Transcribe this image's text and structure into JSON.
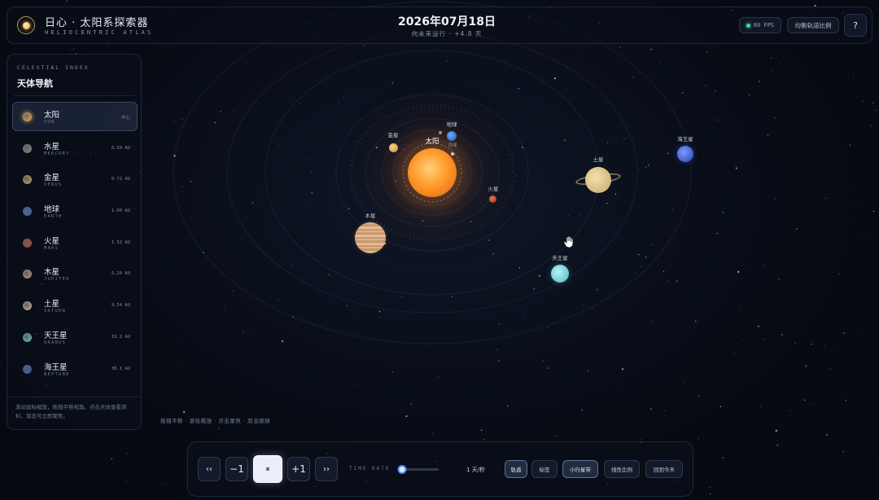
{
  "header": {
    "title": "日心 · 太阳系探索器",
    "subtitle": "HELIOCENTRIC ATLAS",
    "date": "2026年07月18日",
    "direction": "向未来运行 · +4.8 天",
    "fps": "60 FPS",
    "scale_button": "均衡轨道比例",
    "help_button": "?"
  },
  "sidebar": {
    "eyebrow": "CELESTIAL INDEX",
    "title": "天体导航",
    "items": [
      {
        "name": "太阳",
        "en": "SUN",
        "dist": "中心",
        "color": "#f2a93b",
        "active": true
      },
      {
        "name": "水星",
        "en": "MERCURY",
        "dist": "0.39 AU",
        "color": "#8f8a84",
        "active": false
      },
      {
        "name": "金星",
        "en": "VENUS",
        "dist": "0.72 AU",
        "color": "#d9a44a",
        "active": false
      },
      {
        "name": "地球",
        "en": "EARTH",
        "dist": "1.00 AU",
        "color": "#2f6fd0",
        "active": false
      },
      {
        "name": "火星",
        "en": "MARS",
        "dist": "1.52 AU",
        "color": "#c4452c",
        "active": false
      },
      {
        "name": "木星",
        "en": "JUPITER",
        "dist": "5.20 AU",
        "color": "#c89b72",
        "active": false
      },
      {
        "name": "土星",
        "en": "SATURN",
        "dist": "9.54 AU",
        "color": "#d8c08a",
        "active": false
      },
      {
        "name": "天王星",
        "en": "URANUS",
        "dist": "19.2 AU",
        "color": "#5ec8d2",
        "active": false
      },
      {
        "name": "海王星",
        "en": "NEPTUNE",
        "dist": "30.1 AU",
        "color": "#3358c8",
        "active": false
      }
    ],
    "hint": "滚动鼠标缩放，拖拽平移视角。点击天体查看资料，双击可立即聚焦。"
  },
  "canvas": {
    "hint": "拖拽平移 · 滚轮缩放 · 点击聚焦 · 双击跟随",
    "labels": {
      "sun": "太阳",
      "mercury": "水星",
      "venus": "金星",
      "earth": "地球",
      "moon": "月球",
      "mars": "火星",
      "jupiter": "木星",
      "saturn": "土星",
      "uranus": "天王星",
      "neptune": "海王星"
    }
  },
  "controls": {
    "rewind_fast": "‹‹",
    "step_back": "−1",
    "pause": "⏸",
    "step_forward": "+1",
    "forward_fast": "››",
    "time_rate_label": "TIME RATE",
    "rate_fraction": 0.1,
    "rate_readout": "1 天/秒",
    "toggles": [
      {
        "label": "轨道",
        "on": true
      },
      {
        "label": "标签",
        "on": false
      },
      {
        "label": "小行星带",
        "on": true
      },
      {
        "label": "线性比例",
        "on": false
      },
      {
        "label": "回到今天",
        "on": false
      }
    ]
  },
  "colors": {
    "accent": "#4f8cff",
    "sun": "#f2a93b",
    "status_green": "#3ed6a0"
  }
}
